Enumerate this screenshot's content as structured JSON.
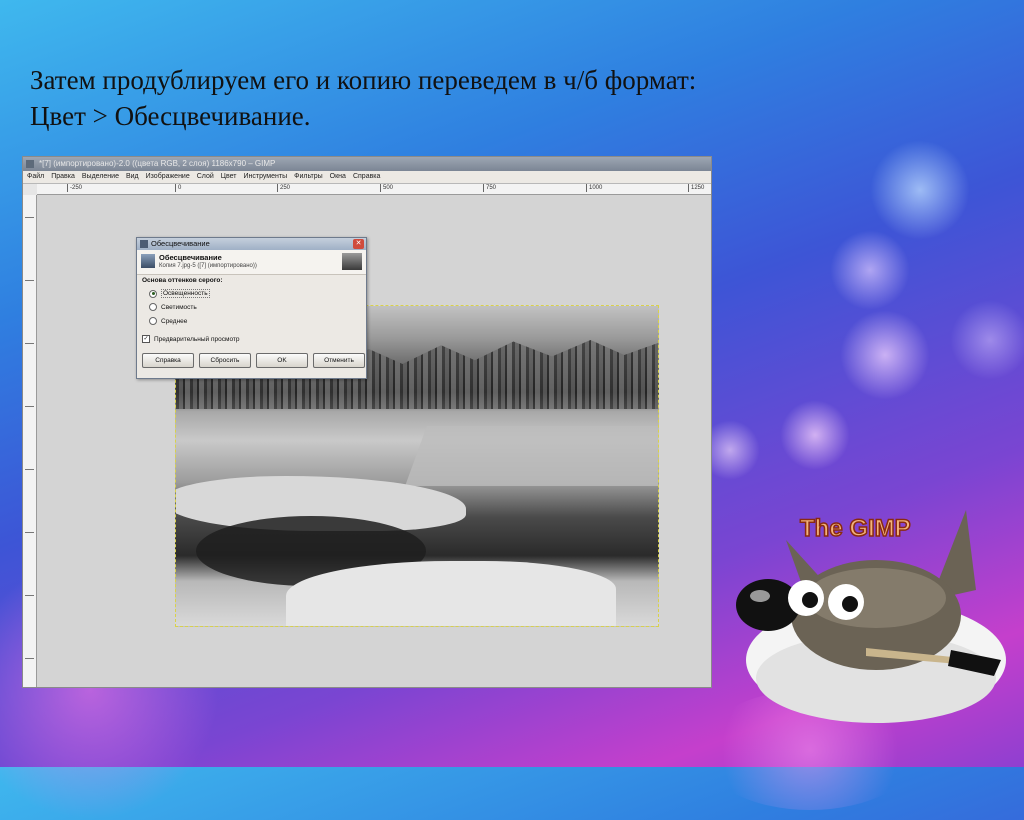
{
  "slide": {
    "line1": "Затем продублируем его и копию переведем в ч/б формат:",
    "line2": "Цвет > Обесцвечивание."
  },
  "gimp": {
    "window_title": "*[7] (импортировано)-2.0 ((цвета RGB, 2 слоя) 1186x790 – GIMP",
    "menu": [
      "Файл",
      "Правка",
      "Выделение",
      "Вид",
      "Изображение",
      "Слой",
      "Цвет",
      "Инструменты",
      "Фильтры",
      "Окна",
      "Справка"
    ],
    "ruler_labels": [
      "-250",
      "0",
      "250",
      "500",
      "750",
      "1000",
      "1250"
    ]
  },
  "dialog": {
    "title": "Обесцвечивание",
    "header_title": "Обесцвечивание",
    "header_subtitle": "Копия 7.jpg-5 ([7] (импортировано))",
    "group_label": "Основа оттенков серого:",
    "options": [
      "Освещенность",
      "Светимость",
      "Среднее"
    ],
    "selected_option": "Освещенность",
    "preview_label": "Предварительный просмотр",
    "preview_checked": true,
    "buttons": {
      "help": "Справка",
      "reset": "Сбросить",
      "ok": "OK",
      "cancel": "Отменить"
    }
  },
  "logo": {
    "text": "The GIMP"
  },
  "colors": {
    "logo_text": "#f2b27a",
    "logo_text_stroke": "#8a2a10",
    "wilber_body": "#6b6355"
  }
}
